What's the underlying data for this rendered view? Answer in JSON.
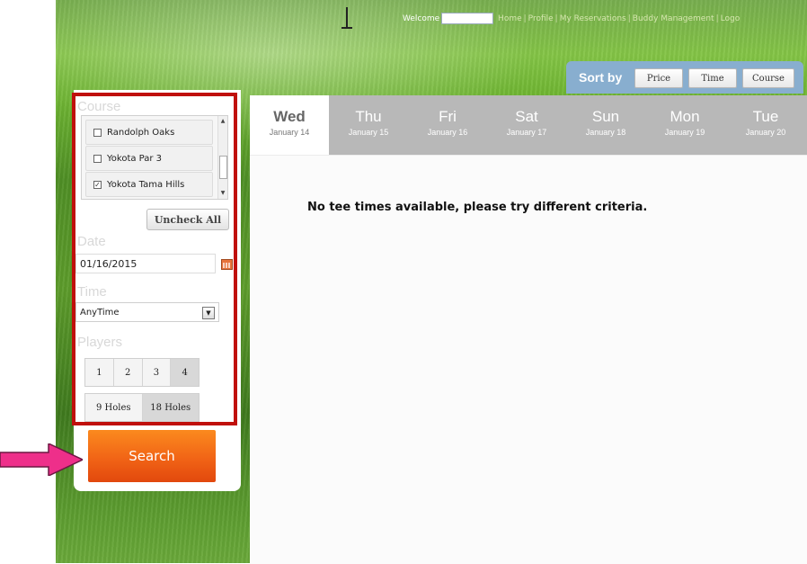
{
  "topbar": {
    "welcome": "Welcome",
    "nav": [
      "Home",
      "Profile",
      "My Reservations",
      "Buddy Management",
      "Logo"
    ]
  },
  "sort": {
    "label": "Sort by",
    "options": [
      "Price",
      "Time",
      "Course"
    ]
  },
  "days": [
    {
      "day": "Wed",
      "date": "January 14",
      "active": true
    },
    {
      "day": "Thu",
      "date": "January 15"
    },
    {
      "day": "Fri",
      "date": "January 16"
    },
    {
      "day": "Sat",
      "date": "January 17"
    },
    {
      "day": "Sun",
      "date": "January 18"
    },
    {
      "day": "Mon",
      "date": "January 19"
    },
    {
      "day": "Tue",
      "date": "January 20"
    }
  ],
  "results": {
    "empty_message": "No tee times available, please try different criteria."
  },
  "filters": {
    "course": {
      "title": "Course",
      "items": [
        {
          "label": "Randolph Oaks",
          "checked": false
        },
        {
          "label": "Yokota Par 3",
          "checked": false
        },
        {
          "label": "Yokota Tama Hills",
          "checked": true
        }
      ],
      "uncheck_all": "Uncheck All"
    },
    "date": {
      "title": "Date",
      "value": "01/16/2015"
    },
    "time": {
      "title": "Time",
      "value": "AnyTime"
    },
    "players": {
      "title": "Players",
      "options": [
        "1",
        "2",
        "3",
        "4"
      ],
      "selected": "4"
    },
    "holes": {
      "options": [
        "9 Holes",
        "18 Holes"
      ],
      "selected": "18 Holes"
    },
    "search": "Search"
  },
  "colors": {
    "highlight_frame": "#c0100b",
    "search_button": "#f16416",
    "annotation_arrow": "#ee2f8a",
    "sort_bar": "#88aecf",
    "inactive_tab": "#b8b8b8"
  }
}
